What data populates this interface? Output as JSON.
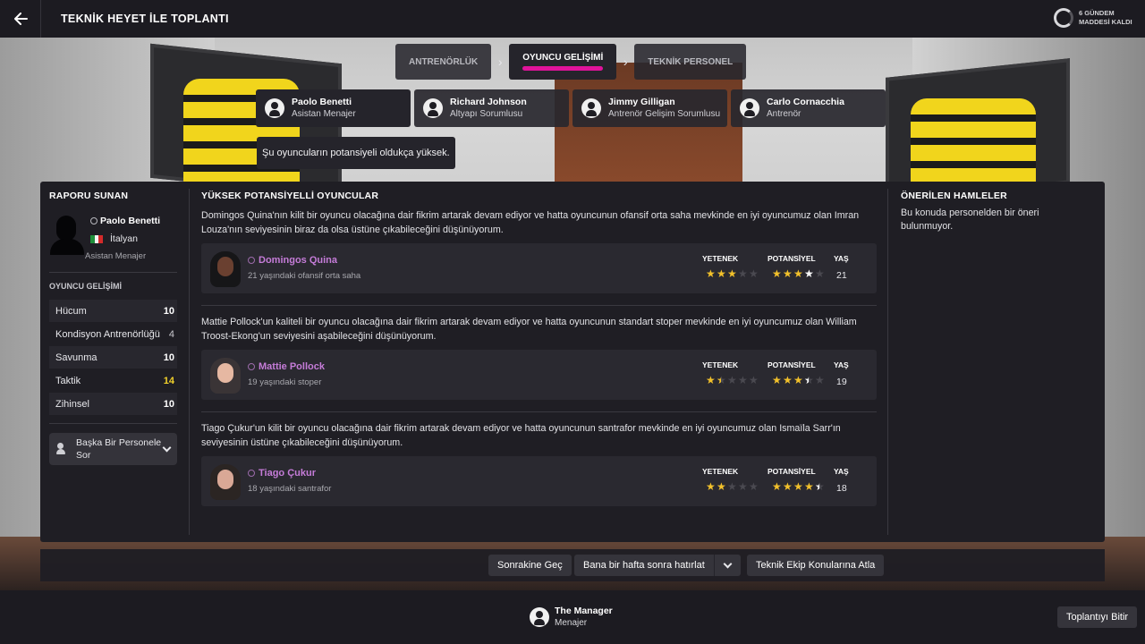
{
  "header": {
    "title": "TEKNİK HEYET İLE TOPLANTI",
    "agenda": "6 GÜNDEM MADDESİ KALDI"
  },
  "stages": [
    {
      "label": "ANTRENÖRLÜK"
    },
    {
      "label": "OYUNCU GELİŞİMİ"
    },
    {
      "label": "TEKNİK PERSONEL"
    }
  ],
  "staff": [
    {
      "name": "Paolo Benetti",
      "role": "Asistan Menajer"
    },
    {
      "name": "Richard Johnson",
      "role": "Altyapı Sorumlusu"
    },
    {
      "name": "Jimmy Gilligan",
      "role": "Antrenör Gelişim Sorumlusu"
    },
    {
      "name": "Carlo Cornacchia",
      "role": "Antrenör"
    }
  ],
  "speech": "Şu oyuncuların potansiyeli oldukça yüksek.",
  "left": {
    "heading": "RAPORU SUNAN",
    "reporter_name": "Paolo Benetti",
    "nationality": "İtalyan",
    "reporter_role": "Asistan Menajer",
    "attr_heading": "OYUNCU GELİŞİMİ",
    "attributes": [
      {
        "name": "Hücum",
        "value": "10"
      },
      {
        "name": "Kondisyon Antrenörlüğü",
        "value": "4"
      },
      {
        "name": "Savunma",
        "value": "10"
      },
      {
        "name": "Taktik",
        "value": "14"
      },
      {
        "name": "Zihinsel",
        "value": "10"
      }
    ],
    "ask_label": "Başka Bir Personele Sor"
  },
  "middle": {
    "heading": "YÜKSEK POTANSİYELLİ OYUNCULAR",
    "col_ability": "YETENEK",
    "col_potential": "POTANSİYEL",
    "col_age": "YAŞ",
    "players": [
      {
        "text": "Domingos Quina'nın kilit bir oyuncu olacağına dair fikrim artarak devam ediyor ve hatta oyuncunun ofansif orta saha mevkinde en iyi oyuncumuz olan Imran Louza'nın seviyesinin biraz da olsa üstüne çıkabileceğini düşünüyorum.",
        "name": "Domingos Quina",
        "desc": "21 yaşındaki ofansif orta saha",
        "ability_stars": 3,
        "potential_stars": 4,
        "age": "21"
      },
      {
        "text": "Mattie Pollock'un kaliteli bir oyuncu olacağına dair fikrim artarak devam ediyor ve hatta oyuncunun standart stoper mevkinde en iyi oyuncumuz olan William Troost-Ekong'un seviyesini aşabileceğini düşünüyorum.",
        "name": "Mattie Pollock",
        "desc": "19 yaşındaki stoper",
        "ability_stars": 1.5,
        "potential_stars": 3.5,
        "age": "19"
      },
      {
        "text": "Tiago Çukur'un kilit bir oyuncu olacağına dair fikrim artarak devam ediyor ve hatta oyuncunun santrafor mevkinde en iyi oyuncumuz olan Ismaïla Sarr'ın seviyesinin üstüne çıkabileceğini düşünüyorum.",
        "name": "Tiago Çukur",
        "desc": "18 yaşındaki santrafor",
        "ability_stars": 2,
        "potential_stars": 4.5,
        "age": "18"
      }
    ]
  },
  "right": {
    "heading": "ÖNERİLEN HAMLELER",
    "text": "Bu konuda personelden bir öneri bulunmuyor."
  },
  "actions": {
    "next": "Sonrakine Geç",
    "remind": "Bana bir hafta sonra hatırlat",
    "skip": "Teknik Ekip Konularına Atla"
  },
  "footer": {
    "manager_name": "The Manager",
    "manager_role": "Menajer",
    "finish": "Toplantıyı Bitir"
  },
  "colors": {
    "accent": "#e0139b",
    "player_name": "#c57cd8",
    "star": "#f2c12b",
    "highlight_value": "#f2d12b"
  }
}
